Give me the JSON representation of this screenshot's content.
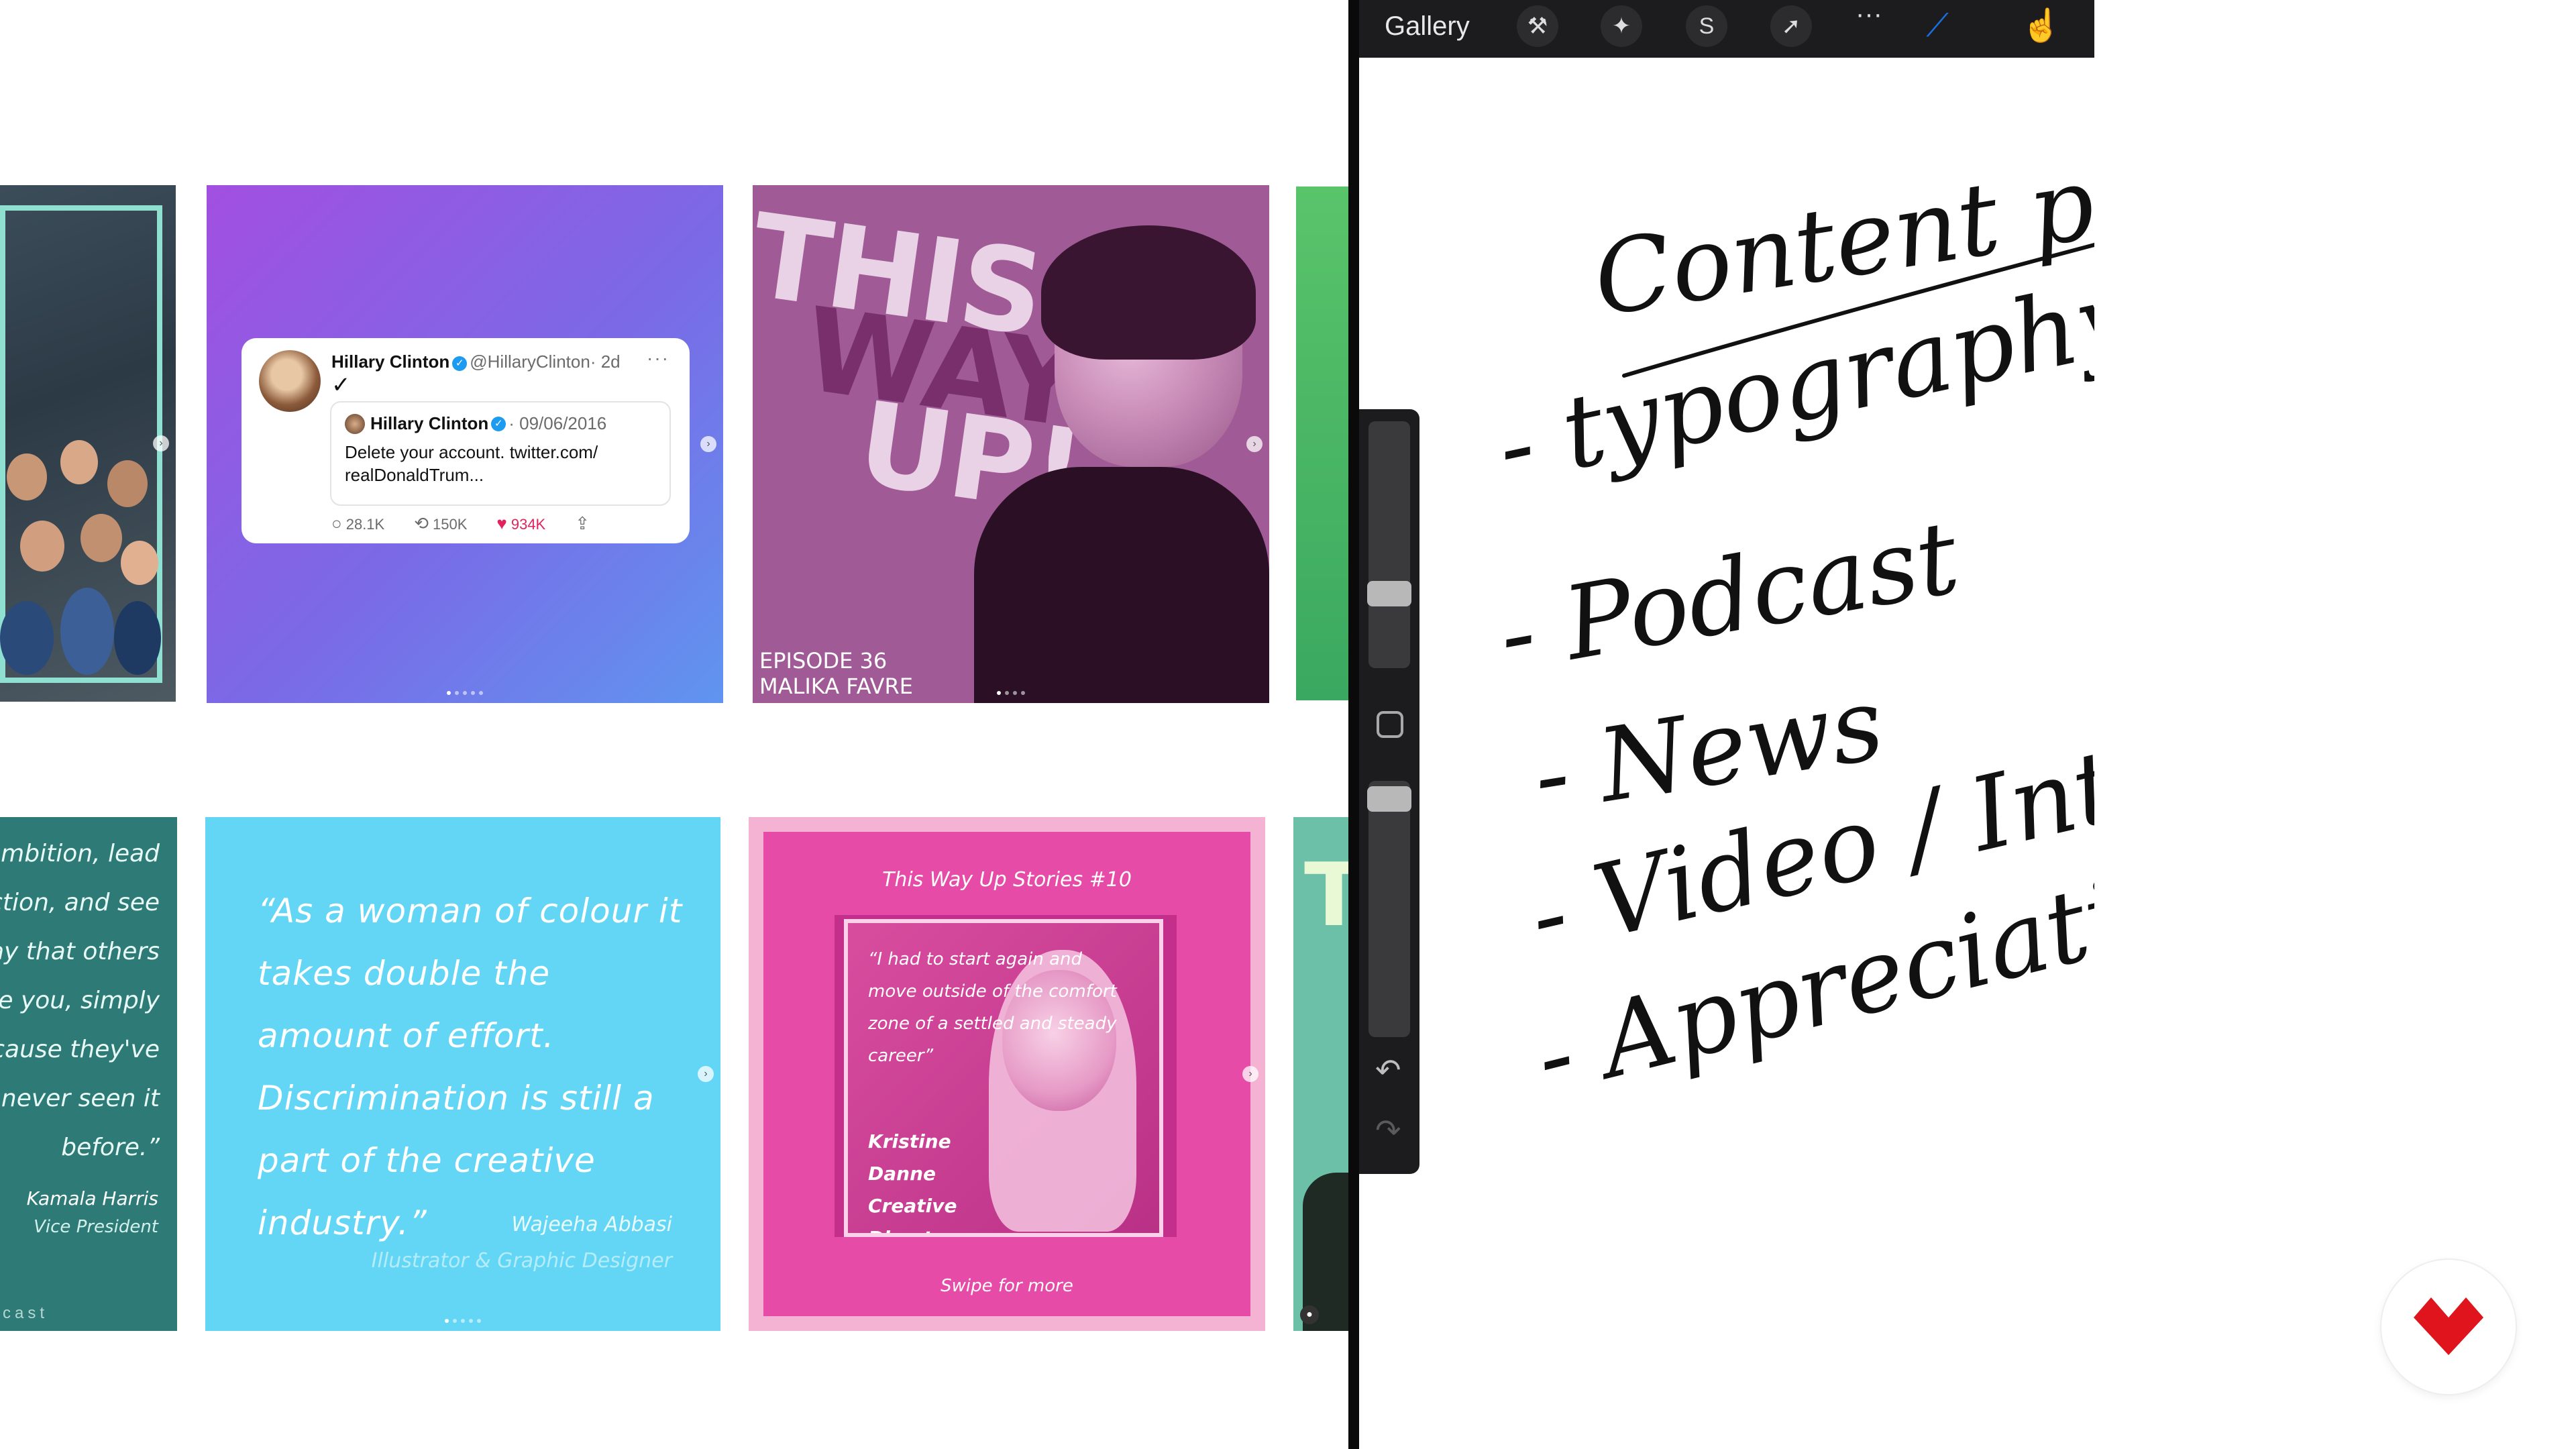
{
  "grid": {
    "tweet": {
      "author": "Hillary Clinton",
      "handle": "@HillaryClinton",
      "age": "· 2d",
      "more": "···",
      "check": "✓",
      "quoted_author": "Hillary Clinton",
      "quoted_date": "· 09/06/2016",
      "quoted_text": "Delete your account. twitter.com/ realDonaldTrum...",
      "replies": "28.1K",
      "retweets": "150K",
      "likes": "934K"
    },
    "episode": {
      "word1": "THIS",
      "word2": "WAY",
      "word3": "UP!",
      "episode_label": "EPISODE 36",
      "guest_name": "MALIKA FAVRE"
    },
    "kamala": {
      "quote": "ambition, lead\niction, and see\nvay that others\nee you, simply\necause they've\nnever seen it\nbefore.”",
      "name": "Kamala Harris",
      "role": "Vice President",
      "footer": "cast"
    },
    "wajeeha": {
      "quote": "“As a woman of colour it takes double the amount of effort. Discrimination is still a part of the creative industry.”",
      "name": "Wajeeha Abbasi",
      "role": "Illustrator & Graphic Designer"
    },
    "kristine": {
      "title": "This Way Up Stories #10",
      "quote": "“I had to start again and move outside of the comfort zone of a settled and steady career”",
      "name": "Kristine Danne\nCreative\nDirector",
      "swipe": "Swipe for more"
    },
    "teal_letter": "T"
  },
  "procreate": {
    "toolbar": {
      "gallery_label": "Gallery",
      "actions_icon": "wrench-icon",
      "adjustments_icon": "magic-wand-icon",
      "selection_icon": "selection-s-icon",
      "transform_icon": "arrow-cursor-icon",
      "more_icon": "···",
      "brush_icon": "brush-icon",
      "smudge_icon": "smudge-icon",
      "brush_color": "#1a6fe0"
    },
    "handwriting": {
      "heading": "Content pillars",
      "items": [
        "- typography / Q",
        "- Podcast",
        "- News",
        "- Video / Inter",
        "- Appreciation"
      ]
    }
  },
  "colors": {
    "logo_red": "#e0141c"
  }
}
